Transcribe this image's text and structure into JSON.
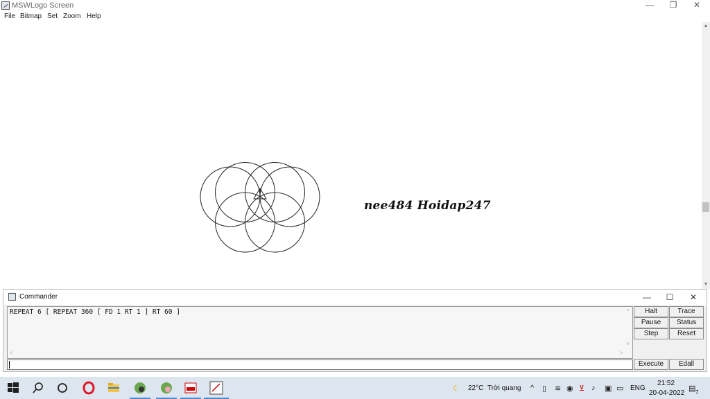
{
  "window": {
    "title": "MSWLogo Screen",
    "minimize": "—",
    "restore": "❐",
    "close": "✕"
  },
  "menu": {
    "items": [
      "File",
      "Bitmap",
      "Set",
      "Zoom",
      "Help"
    ]
  },
  "canvas": {
    "signature": "nee484 Hoidap247",
    "drawing": "six-circle rosette"
  },
  "commander": {
    "title": "Commander",
    "minimize": "—",
    "maximize": "☐",
    "close": "✕",
    "history_line": "REPEAT 6 [ REPEAT 360 [ FD 1 RT 1 ] RT 60 ]",
    "input_value": "",
    "buttons": {
      "halt": "Halt",
      "trace": "Trace",
      "pause": "Pause",
      "status": "Status",
      "step": "Step",
      "reset": "Reset",
      "execute": "Execute",
      "edall": "Edall"
    }
  },
  "taskbar": {
    "weather_temp": "22°C",
    "weather_text": "Trời quang",
    "language": "ENG",
    "time": "21:52",
    "date": "20-04-2022",
    "notification_count": "7",
    "icons": [
      "windows-start-icon",
      "search-icon",
      "task-view-icon",
      "opera-icon",
      "file-explorer-icon",
      "app-icon-1",
      "app-icon-2",
      "app-icon-3",
      "mswlogo-icon"
    ]
  },
  "colors": {
    "taskbar": "#dde5ee",
    "accent": "#4a89d6",
    "stroke": "#222222"
  }
}
